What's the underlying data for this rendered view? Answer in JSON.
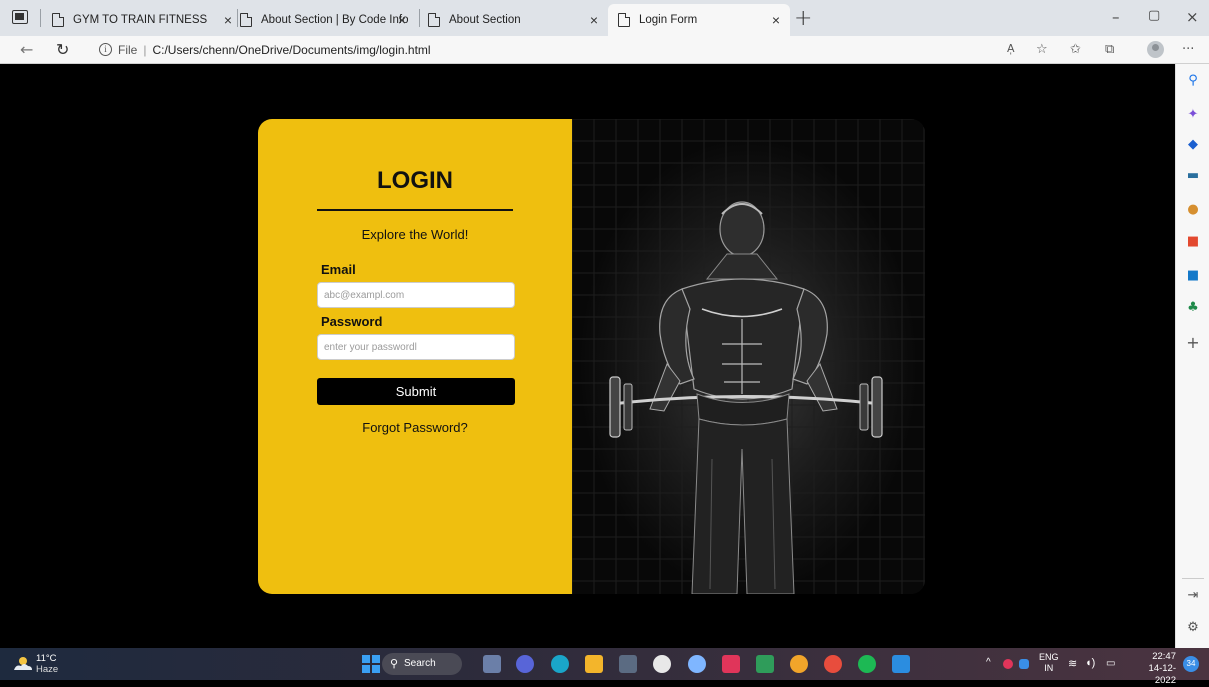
{
  "browser": {
    "tabs": [
      {
        "label": "GYM TO TRAIN FITNESS",
        "close": "×"
      },
      {
        "label": "About Section | By Code Info",
        "close": "×"
      },
      {
        "label": "About Section",
        "close": "×"
      },
      {
        "label": "Login Form",
        "close": "×",
        "active": true
      }
    ],
    "new_tab": "+",
    "window_controls": {
      "minimize": "–",
      "restore": "▢",
      "close": "×"
    },
    "address": {
      "scheme_label": "File",
      "url": "C:/Users/chenn/OneDrive/Documents/img/login.html"
    },
    "toolbar_icons": [
      "read-aloud-icon",
      "add-favorite-icon",
      "favorites-icon",
      "collections-icon",
      "profile-icon",
      "more-icon"
    ],
    "more_label": "···",
    "read_aloud_label": "A̩"
  },
  "sidebar": {
    "icons": [
      "search-icon",
      "copilot-icon",
      "shopping-tag-icon",
      "tools-icon",
      "games-icon",
      "office-icon",
      "outlook-icon",
      "tree-icon",
      "add-icon"
    ],
    "add_label": "+"
  },
  "login": {
    "title": "LOGIN",
    "subtitle": "Explore the World!",
    "email_label": "Email",
    "email_placeholder": "abc@exampl.com",
    "password_label": "Password",
    "password_placeholder": "enter your passwordl",
    "submit_label": "Submit",
    "forgot_label": "Forgot Password?"
  },
  "colors": {
    "panel": "#efbf0f",
    "button": "#000000",
    "page_bg": "#000000"
  },
  "taskbar": {
    "weather": {
      "temp": "11°C",
      "desc": "Haze"
    },
    "search_label": "Search",
    "tray": {
      "lang": "ENG",
      "region": "IN"
    },
    "clock": {
      "time": "22:47",
      "date": "14-12-2022"
    },
    "notification_count": "34"
  }
}
